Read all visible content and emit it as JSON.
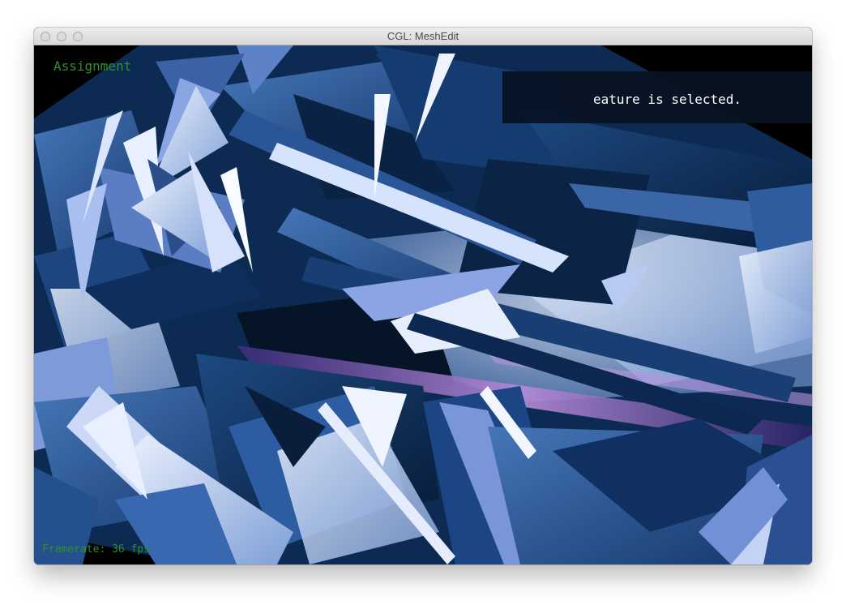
{
  "window": {
    "title": "CGL: MeshEdit"
  },
  "hud": {
    "assignment_label": "Assignment",
    "status_message": "eature is selected.",
    "framerate": "Framerate: 36 fps"
  },
  "colors": {
    "hud_text": "#2f8f2a",
    "status_text": "#ffffff",
    "background": "#000000",
    "mesh_dark": "#0c2a52",
    "mesh_mid": "#2c5a96",
    "mesh_light": "#c8d8f6",
    "mesh_purple": "#8a6ccc"
  }
}
